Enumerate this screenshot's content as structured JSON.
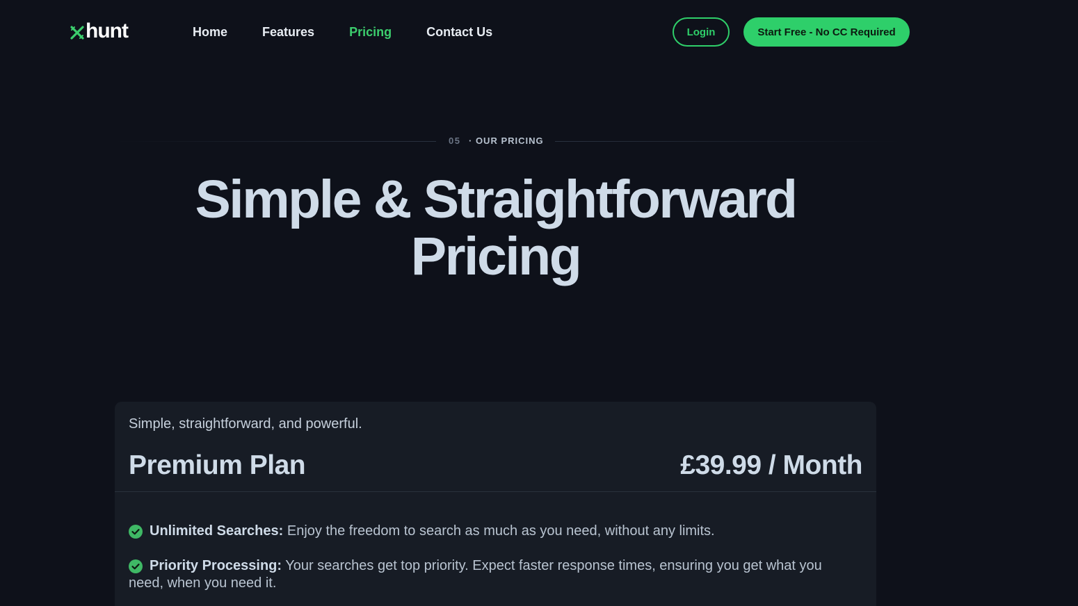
{
  "header": {
    "logo_text": "hunt",
    "logo_mark": "x",
    "nav": [
      {
        "label": "Home",
        "active": false
      },
      {
        "label": "Features",
        "active": false
      },
      {
        "label": "Pricing",
        "active": true
      },
      {
        "label": "Contact Us",
        "active": false
      }
    ],
    "login_label": "Login",
    "cta_label": "Start Free - No CC Required"
  },
  "section": {
    "number": "05",
    "label": "· OUR PRICING",
    "headline_line1": "Simple & Straightforward",
    "headline_line2": "Pricing"
  },
  "pricing_card": {
    "tagline": "Simple, straightforward, and powerful.",
    "plan_name": "Premium Plan",
    "price": "£39.99 / Month",
    "features": [
      {
        "title": "Unlimited Searches:",
        "description": "Enjoy the freedom to search as much as you need, without any limits.",
        "icon": "check-circle-icon"
      },
      {
        "title": "Priority Processing:",
        "description": "Your searches get top priority. Expect faster response times, ensuring you get what you need, when you need it.",
        "icon": "check-circle-icon"
      }
    ]
  },
  "colors": {
    "background": "#0e111a",
    "accent": "#2ecf6a",
    "card": "#171c25",
    "heading": "#cfdbe8"
  }
}
